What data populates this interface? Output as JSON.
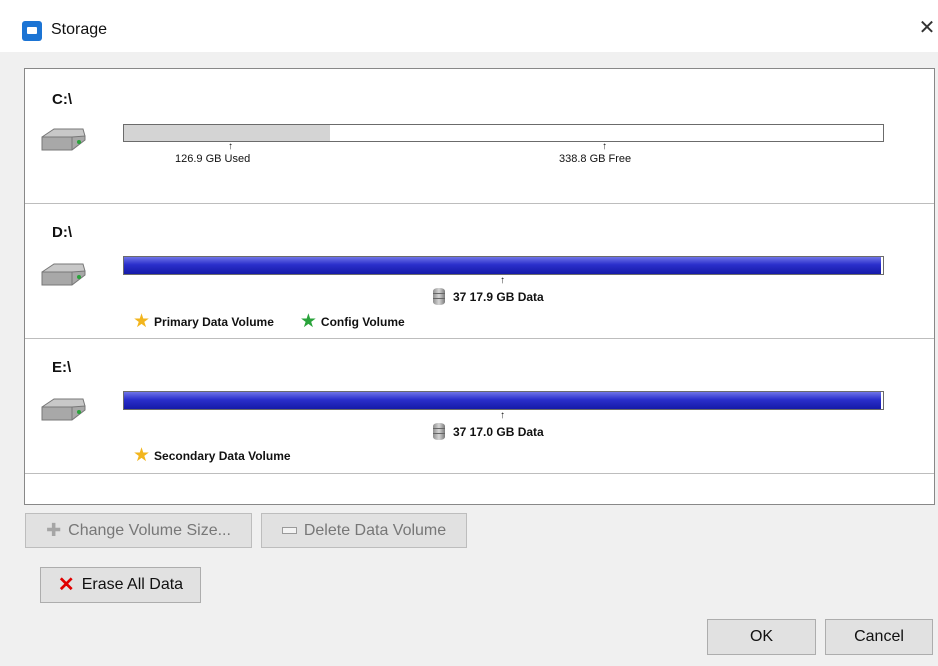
{
  "window": {
    "title": "Storage",
    "close_icon": "close-icon"
  },
  "volumes": [
    {
      "drive": "C:\\",
      "icon": "hard-drive-icon",
      "used_fraction": 0.272,
      "used_label": "126.9 GB Used",
      "free_label": "338.8 GB Free"
    },
    {
      "drive": "D:\\",
      "icon": "hard-drive-icon",
      "data_fraction": 0.997,
      "data_label": "37 17.9 GB Data",
      "tags": [
        {
          "label": "Primary Data Volume",
          "color": "#f2b51d",
          "icon": "star-icon"
        },
        {
          "label": "Config Volume",
          "color": "#2aa33b",
          "icon": "star-icon"
        }
      ]
    },
    {
      "drive": "E:\\",
      "icon": "hard-drive-icon",
      "data_fraction": 0.997,
      "data_label": "37 17.0 GB Data",
      "tags": [
        {
          "label": "Secondary Data Volume",
          "color": "#f2b51d",
          "icon": "star-icon"
        }
      ]
    }
  ],
  "buttons": {
    "change_volume_size": "Change Volume Size...",
    "delete_data_volume": "Delete Data Volume",
    "erase_all_data": "Erase All Data",
    "ok": "OK",
    "cancel": "Cancel"
  },
  "colors": {
    "accent": "#1c74d4",
    "used_bar": "#d4d4d4",
    "data_bar": "#2a2fcb",
    "erase_icon": "#e00000"
  }
}
